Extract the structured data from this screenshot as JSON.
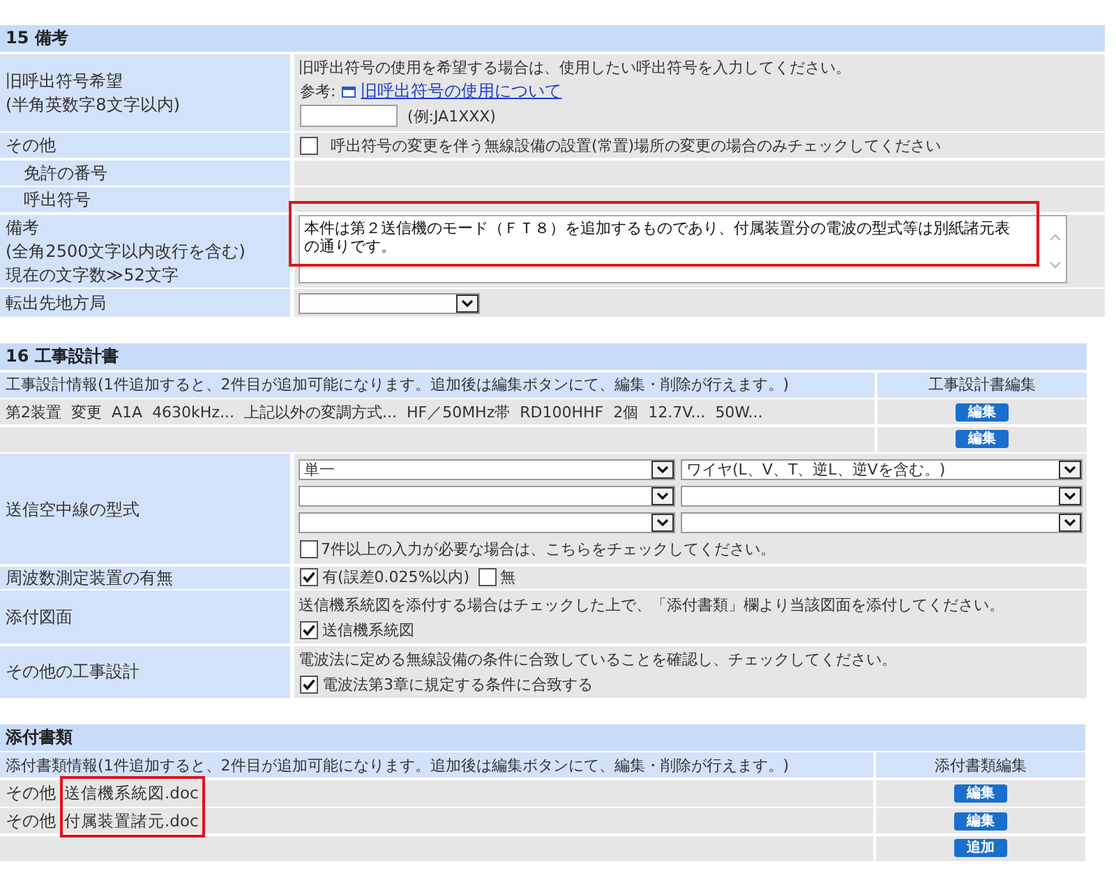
{
  "section_15": {
    "title": "15 備考",
    "old_callsign": {
      "label": "旧呼出符号希望",
      "note": "(半角英数字8文字以内)",
      "instruction": "旧呼出符号の使用を希望する場合は、使用したい呼出符号を入力してください。",
      "reference_label": "参考:",
      "reference_link": "旧呼出符号の使用について",
      "example": "(例:JA1XXX)"
    },
    "location_change": {
      "label": "その他",
      "checked": false,
      "text": "呼出符号の変更を伴う無線設備の設置(常置)場所の変更の場合のみチェックしてください"
    },
    "sub_rows": [
      {
        "label": "免許の番号"
      },
      {
        "label": "呼出符号"
      }
    ],
    "remarks": {
      "label": "備考",
      "note": "(全角2500文字以内改行を含む)",
      "count": "現在の文字数≫52文字",
      "value": "本件は第２送信機のモード（ＦＴ８）を追加するものであり、付属装置分の電波の型式等は別紙諸元表の通りです。",
      "highlighted": true
    },
    "transfer": {
      "label": "転出先地方局"
    }
  },
  "section_16": {
    "title": "16 工事設計書",
    "columns": [
      "工事設計情報(1件追加すると、2件目が追加可能になります。追加後は編集ボタンにて、編集・削除が行えます。)",
      "工事設計書編集"
    ],
    "rows": [
      {
        "summary": [
          "第2装置",
          "変更",
          "A1A",
          "4630kHz...",
          "上記以外の変調方式...",
          "HF／50MHz帯",
          "RD100HHF",
          "2個",
          "12.7V...",
          "50W..."
        ],
        "button": "編集"
      },
      {
        "button": "編集"
      }
    ],
    "antenna": {
      "label": "送信空中線の型式",
      "selects": [
        {
          "column_1": "単一",
          "column_2": "ワイヤ(L、V、T、逆L、逆Vを含む。)"
        }
      ],
      "overflow": {
        "checked": false,
        "text": "7件以上の入力が必要な場合は、こちらをチェックしてください。"
      }
    },
    "frequency_meter": {
      "label": "周波数測定装置の有無",
      "options": [
        {
          "label": "有(誤差0.025%以内)",
          "checked": true
        },
        {
          "label": "無",
          "checked": false
        }
      ]
    },
    "drawings": {
      "label": "添付図面",
      "instruction": "送信機系統図を添付する場合はチェックした上で、「添付書類」欄より当該図面を添付してください。",
      "option": {
        "label": "送信機系統図",
        "checked": true
      }
    },
    "other_design": {
      "label": "その他の工事設計",
      "instruction": "電波法に定める無線設備の条件に合致していることを確認し、チェックしてください。",
      "option": {
        "label": "電波法第3章に規定する条件に合致する",
        "checked": true
      }
    }
  },
  "attachments": {
    "title": "添付書類",
    "columns": [
      "添付書類情報(1件追加すると、2件目が追加可能になります。追加後は編集ボタンにて、編集・削除が行えます。)",
      "添付書類編集"
    ],
    "rows": [
      {
        "category": "その他",
        "file": "送信機系統図.doc",
        "button": "編集"
      },
      {
        "category": "その他",
        "file": "付属装置諸元.doc",
        "button": "編集"
      }
    ],
    "add_button": "追加",
    "files_highlighted": true
  }
}
